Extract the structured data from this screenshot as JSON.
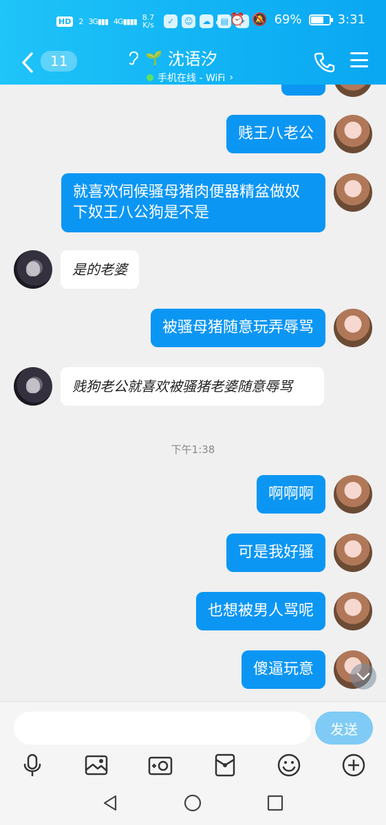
{
  "status_bar": {
    "hd_label": "HD",
    "sim_label": "2",
    "network_3g": "3G",
    "network_4g": "4G",
    "speed_value": "8.7",
    "speed_unit": "K/s",
    "battery_percent": "69%",
    "battery_level": 0.69,
    "time": "3:31"
  },
  "header": {
    "back_icon": "chevron-left-icon",
    "unread_count": "11",
    "contact_name": "沈语汐",
    "online_status": "手机在线 - WiFi",
    "chevron": "›"
  },
  "messages": [
    {
      "from": "me",
      "text": "贱王八老公"
    },
    {
      "from": "me",
      "text": "就喜欢伺候骚母猪肉便器精盆做奴下奴王八公狗是不是"
    },
    {
      "from": "other",
      "text": "是的老婆"
    },
    {
      "from": "me",
      "text": "被骚母猪随意玩弄辱骂"
    },
    {
      "from": "other",
      "text": "贱狗老公就喜欢被骚猪老婆随意辱骂"
    },
    {
      "from": "me",
      "text": "啊啊啊"
    },
    {
      "from": "me",
      "text": "可是我好骚"
    },
    {
      "from": "me",
      "text": "也想被男人骂呢"
    },
    {
      "from": "me",
      "text": "傻逼玩意"
    }
  ],
  "timestamp": "下午1:38",
  "input": {
    "placeholder": "",
    "value": "",
    "send_label": "发送"
  },
  "toolbar_icons": [
    "microphone-icon",
    "image-icon",
    "camera-icon",
    "red-packet-icon",
    "emoji-icon",
    "plus-icon"
  ],
  "colors": {
    "header_start": "#1fc4f8",
    "header_end": "#0aa7f2",
    "bubble_me": "#0c96f3",
    "bubble_other": "#ffffff",
    "send_button": "#7fcbf5"
  }
}
